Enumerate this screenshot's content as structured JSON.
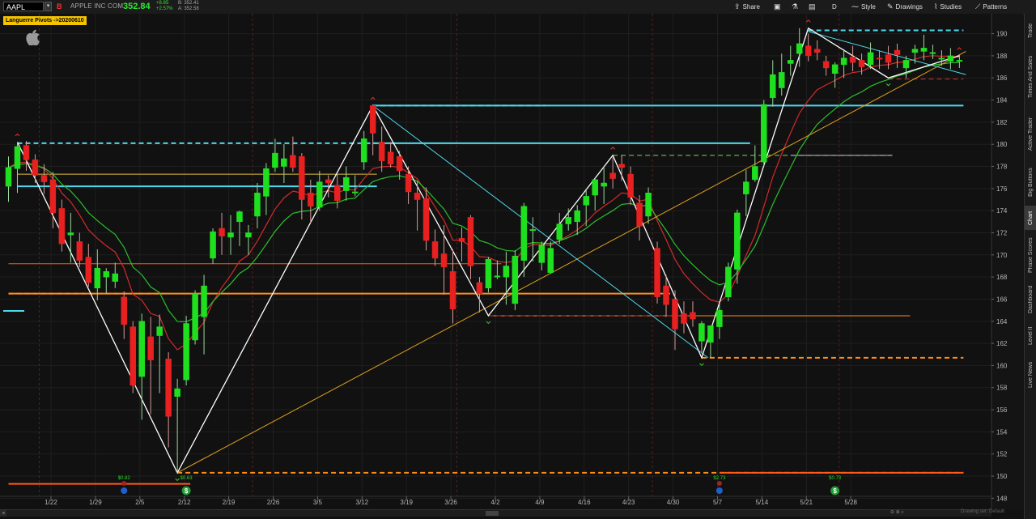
{
  "topbar": {
    "symbol": "AAPL",
    "symbol_badge": "B",
    "company": "APPLE INC COM",
    "last": "352.84",
    "change1": "+8.85",
    "change2": "+2.57%",
    "bid": "B: 352.41",
    "ask": "A: 352.58",
    "share": "Share",
    "timeframe": "D",
    "style": "Style",
    "drawings": "Drawings",
    "studies": "Studies",
    "patterns": "Patterns"
  },
  "study_label": "Languerre Pivots ->20200610",
  "sidebar": [
    "Trade",
    "Times And Sales",
    "Active Trader",
    "Big Buttons",
    "Chart",
    "Phase Scores",
    "Dashboard",
    "Level II",
    "Live News"
  ],
  "sidebar_active": "Chart",
  "footer": {
    "drawing_mode": "Drawing set: Default"
  },
  "chart_data": {
    "type": "candlestick",
    "ylim": [
      147,
      191.8
    ],
    "y_ticks": [
      148,
      150,
      152,
      154,
      156,
      158,
      160,
      162,
      164,
      166,
      168,
      170,
      172,
      174,
      176,
      178,
      180,
      182,
      184,
      186,
      188,
      190
    ],
    "x_ticks": [
      "1/22",
      "1/29",
      "2/5",
      "2/12",
      "2/19",
      "2/26",
      "3/5",
      "3/12",
      "3/19",
      "3/26",
      "4/2",
      "4/9",
      "4/16",
      "4/23",
      "4/30",
      "5/7",
      "5/14",
      "5/21",
      "5/28"
    ],
    "colors": {
      "up": "#1fe01f",
      "down": "#e82020",
      "zigzag": "#ffffff",
      "cyan": "#4fd8ec",
      "orange": "#ff8c1a",
      "ma_red": "#d42a2a",
      "ma_green": "#2bbf2b",
      "trend": "#e0a020"
    },
    "candles": [
      [
        176.2,
        178.9,
        174.8,
        177.9
      ],
      [
        177.8,
        180.2,
        175.6,
        179.8
      ],
      [
        179.9,
        180.3,
        177.6,
        178.6
      ],
      [
        178.6,
        179.1,
        176.5,
        177.2
      ],
      [
        177.2,
        178.2,
        175.5,
        176.6
      ],
      [
        176.8,
        177.5,
        172.4,
        173.8
      ],
      [
        174.2,
        175.0,
        170.3,
        171.0
      ],
      [
        171.8,
        173.8,
        169.3,
        172.0
      ],
      [
        171.2,
        172.0,
        168.9,
        169.5
      ],
      [
        169.8,
        171.0,
        167.1,
        167.5
      ],
      [
        167.0,
        170.5,
        165.9,
        168.8
      ],
      [
        168.0,
        168.8,
        166.5,
        168.5
      ],
      [
        167.6,
        169.3,
        167.0,
        168.3
      ],
      [
        166.2,
        166.7,
        162.4,
        163.7
      ],
      [
        163.5,
        164.0,
        157.5,
        158.2
      ],
      [
        159.0,
        164.7,
        155.1,
        164.0
      ],
      [
        162.6,
        164.4,
        155.6,
        160.5
      ],
      [
        162.7,
        164.6,
        157.5,
        163.5
      ],
      [
        160.6,
        161.2,
        152.6,
        155.4
      ],
      [
        157.2,
        158.8,
        150.3,
        157.9
      ],
      [
        158.7,
        164.5,
        158.2,
        163.8
      ],
      [
        162.3,
        166.8,
        161.9,
        166.5
      ],
      [
        164.4,
        168.2,
        161.0,
        167.2
      ],
      [
        169.7,
        172.4,
        169.2,
        172.1
      ],
      [
        172.4,
        173.8,
        170.0,
        171.7
      ],
      [
        171.6,
        173.6,
        170.0,
        172.0
      ],
      [
        173.0,
        174.0,
        170.8,
        173.9
      ],
      [
        171.6,
        172.7,
        170.0,
        172.0
      ],
      [
        173.5,
        176.5,
        172.4,
        175.6
      ],
      [
        175.3,
        178.3,
        173.6,
        177.8
      ],
      [
        177.9,
        180.5,
        177.5,
        179.2
      ],
      [
        178.0,
        180.0,
        176.5,
        178.7
      ],
      [
        179.0,
        180.7,
        177.5,
        177.9
      ],
      [
        178.9,
        179.2,
        173.2,
        175.0
      ],
      [
        175.6,
        176.8,
        172.9,
        174.4
      ],
      [
        174.3,
        177.6,
        174.0,
        176.6
      ],
      [
        176.8,
        177.2,
        175.2,
        176.5
      ],
      [
        176.3,
        177.3,
        174.2,
        174.9
      ],
      [
        175.8,
        178.0,
        174.9,
        177.0
      ],
      [
        175.7,
        177.2,
        175.3,
        175.7
      ],
      [
        178.4,
        181.2,
        177.7,
        180.5
      ],
      [
        183.5,
        183.5,
        179.0,
        181.0
      ],
      [
        180.2,
        181.6,
        177.5,
        178.5
      ],
      [
        179.3,
        180.2,
        177.9,
        178.2
      ],
      [
        178.9,
        179.4,
        176.8,
        177.6
      ],
      [
        177.3,
        178.0,
        174.6,
        175.7
      ],
      [
        175.6,
        176.7,
        172.2,
        175.0
      ],
      [
        175.1,
        176.1,
        170.4,
        171.3
      ],
      [
        171.2,
        172.3,
        169.0,
        169.7
      ],
      [
        170.1,
        172.7,
        166.4,
        168.9
      ],
      [
        168.5,
        170.5,
        163.8,
        165.1
      ],
      [
        171.5,
        172.5,
        169.4,
        171.2
      ],
      [
        173.4,
        173.6,
        167.8,
        169.0
      ],
      [
        167.5,
        168.0,
        164.8,
        166.5
      ],
      [
        167.0,
        169.8,
        166.6,
        169.6
      ],
      [
        168.0,
        169.5,
        167.8,
        168.1
      ],
      [
        168.0,
        170.3,
        165.5,
        169.0
      ],
      [
        165.6,
        170.4,
        165.0,
        169.9
      ],
      [
        169.5,
        174.7,
        168.0,
        174.4
      ],
      [
        172.2,
        173.4,
        169.4,
        172.3
      ],
      [
        169.3,
        171.2,
        168.6,
        170.9
      ],
      [
        168.4,
        171.2,
        168.3,
        170.6
      ],
      [
        171.4,
        173.8,
        171.0,
        172.8
      ],
      [
        172.8,
        174.2,
        172.2,
        173.4
      ],
      [
        173.0,
        174.5,
        171.8,
        174.0
      ],
      [
        174.5,
        176.0,
        172.6,
        175.3
      ],
      [
        175.4,
        177.0,
        174.0,
        176.8
      ],
      [
        176.2,
        178.0,
        174.6,
        176.5
      ],
      [
        177.4,
        178.8,
        176.0,
        176.9
      ],
      [
        178.2,
        179.0,
        176.7,
        177.9
      ],
      [
        177.3,
        178.0,
        174.5,
        175.2
      ],
      [
        174.7,
        175.4,
        171.3,
        172.6
      ],
      [
        173.5,
        176.1,
        172.8,
        175.6
      ],
      [
        170.6,
        171.2,
        165.6,
        166.2
      ],
      [
        167.2,
        168.2,
        164.4,
        165.5
      ],
      [
        166.0,
        166.8,
        161.4,
        163.3
      ],
      [
        164.7,
        165.8,
        162.9,
        163.8
      ],
      [
        164.8,
        165.8,
        163.5,
        164.2
      ],
      [
        162.2,
        164.0,
        161.2,
        163.8
      ],
      [
        162.1,
        163.6,
        160.7,
        163.6
      ],
      [
        163.5,
        165.6,
        162.4,
        165.0
      ],
      [
        166.2,
        169.3,
        165.8,
        168.9
      ],
      [
        168.7,
        174.1,
        167.4,
        173.8
      ],
      [
        175.5,
        177.7,
        173.5,
        176.6
      ],
      [
        176.8,
        179.9,
        176.6,
        178.0
      ],
      [
        178.4,
        184.0,
        178.0,
        183.6
      ],
      [
        184.2,
        187.6,
        183.4,
        186.3
      ],
      [
        185.1,
        188.2,
        184.4,
        186.5
      ],
      [
        187.3,
        188.9,
        186.2,
        187.6
      ],
      [
        188.2,
        190.5,
        187.0,
        189.1
      ],
      [
        188.9,
        190.0,
        187.5,
        188.0
      ],
      [
        188.6,
        189.4,
        187.6,
        188.3
      ],
      [
        187.5,
        188.0,
        186.2,
        186.9
      ],
      [
        186.4,
        187.4,
        185.1,
        187.2
      ],
      [
        187.2,
        188.6,
        186.0,
        187.8
      ],
      [
        187.9,
        188.9,
        186.6,
        187.4
      ],
      [
        187.6,
        188.2,
        186.3,
        187.0
      ],
      [
        187.2,
        189.2,
        186.8,
        188.3
      ],
      [
        187.8,
        188.5,
        186.8,
        187.7
      ],
      [
        188.1,
        188.9,
        186.8,
        187.4
      ],
      [
        188.5,
        189.1,
        186.9,
        188.1
      ],
      [
        186.9,
        188.0,
        186.0,
        187.6
      ],
      [
        188.3,
        189.0,
        187.3,
        188.6
      ],
      [
        188.4,
        189.9,
        187.6,
        188.7
      ],
      [
        188.2,
        189.0,
        187.7,
        188.3
      ],
      [
        187.7,
        188.5,
        187.1,
        187.8
      ],
      [
        187.5,
        188.7,
        186.8,
        188.0
      ],
      [
        187.6,
        188.1,
        186.9,
        187.6
      ]
    ],
    "zigzag": [
      [
        1,
        180.2
      ],
      [
        19,
        150.3
      ],
      [
        41,
        183.5
      ],
      [
        54,
        164.5
      ],
      [
        68,
        179.0
      ],
      [
        78,
        160.7
      ],
      [
        90,
        190.5
      ],
      [
        99,
        186.0
      ],
      [
        107,
        188.0
      ]
    ],
    "pivot_levels": [
      {
        "price": 180.1,
        "from": 1,
        "to": 41,
        "color": "#4fd8ec",
        "style": "dash"
      },
      {
        "price": 176.2,
        "from": 1,
        "to": 41,
        "color": "#4fd8ec",
        "style": "solid"
      },
      {
        "price": 177.3,
        "from": 1,
        "to": 41,
        "color": "#e0c040",
        "style": "solid",
        "thin": true
      },
      {
        "price": 183.5,
        "from": 41,
        "to": 107,
        "color": "#4fd8ec",
        "style": "solid"
      },
      {
        "price": 183.5,
        "from": 41,
        "to": 60,
        "color": "#4fd8ec",
        "style": "dash"
      },
      {
        "price": 180.1,
        "from": 41,
        "to": 83,
        "color": "#4fd8ec",
        "style": "solid"
      },
      {
        "price": 190.3,
        "from": 90,
        "to": 107,
        "color": "#4fd8ec",
        "style": "dash"
      },
      {
        "price": 166.5,
        "from": 0,
        "to": 74,
        "color": "#ff8c1a",
        "style": "solid"
      },
      {
        "price": 166.5,
        "from": 0,
        "to": 17,
        "color": "#ff8c1a",
        "style": "dash"
      },
      {
        "price": 150.3,
        "from": 19,
        "to": 107,
        "color": "#ff8c1a",
        "style": "dash"
      },
      {
        "price": 150.3,
        "from": 80,
        "to": 107,
        "color": "#ff5a1a",
        "style": "solid"
      },
      {
        "price": 149.3,
        "from": 0,
        "to": 20,
        "color": "#ff5a1a",
        "style": "solid"
      },
      {
        "price": 160.7,
        "from": 78,
        "to": 107,
        "color": "#ff8c1a",
        "style": "dash"
      },
      {
        "price": 164.5,
        "from": 54,
        "to": 101,
        "color": "#ff8c1a",
        "style": "solid",
        "thin": true
      },
      {
        "price": 164.5,
        "from": 54,
        "to": 77,
        "color": "#d43030",
        "style": "dash",
        "thin": true
      },
      {
        "price": 169.2,
        "from": 0,
        "to": 55,
        "color": "#ff5a1a",
        "style": "solid",
        "thin": true
      },
      {
        "price": 179.0,
        "from": 68,
        "to": 99,
        "color": "#7bd84f",
        "style": "dash",
        "thin": true
      },
      {
        "price": 179.0,
        "from": 88,
        "to": 99,
        "color": "#bbbbbb",
        "style": "solid",
        "thin": true
      },
      {
        "price": 185.9,
        "from": 99,
        "to": 107,
        "color": "#d43030",
        "style": "dash",
        "thin": true
      }
    ],
    "trendlines": [
      {
        "points": [
          [
            19,
            150.3
          ],
          [
            107,
            188.4
          ]
        ],
        "color": "#e0a020"
      },
      {
        "points": [
          [
            41,
            183.5
          ],
          [
            78,
            160.7
          ]
        ],
        "color": "#4fd8ec"
      },
      {
        "points": [
          [
            90,
            190.2
          ],
          [
            107,
            186.3
          ]
        ],
        "color": "#4fd8ec"
      }
    ],
    "events": [
      {
        "i": 13,
        "value": "$0.82",
        "type": "D"
      },
      {
        "i": 20,
        "value": "$0.63",
        "type": "$"
      },
      {
        "i": 80,
        "value": "$2.73",
        "type": "D"
      },
      {
        "i": 93,
        "value": "$0.73",
        "type": "$"
      }
    ]
  }
}
